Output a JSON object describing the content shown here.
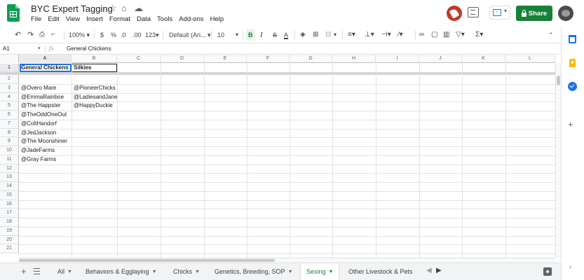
{
  "header": {
    "title": "BYC Expert Tagging",
    "menu": [
      "File",
      "Edit",
      "View",
      "Insert",
      "Format",
      "Data",
      "Tools",
      "Add-ons",
      "Help"
    ],
    "share_label": "Share"
  },
  "toolbar": {
    "zoom": "100%",
    "currency": "$",
    "percent": "%",
    "decimal_decrease": ".0",
    "decimal_increase": ".00",
    "more_formats": "123",
    "font": "Default (Ari...",
    "font_size": "10",
    "bold": "B",
    "italic": "I",
    "strike": "S",
    "text_color": "A",
    "functions": "Σ"
  },
  "formula_bar": {
    "cell_ref": "A1",
    "fx": "fx",
    "value": "General Chickens"
  },
  "grid": {
    "columns": [
      "A",
      "B",
      "C",
      "D",
      "E",
      "F",
      "G",
      "H",
      "I",
      "J",
      "K",
      "L"
    ],
    "rows": [
      "1",
      "2",
      "3",
      "4",
      "5",
      "6",
      "7",
      "8",
      "9",
      "10",
      "11",
      "12",
      "13",
      "14",
      "15",
      "16",
      "17",
      "18",
      "19",
      "20",
      "21"
    ],
    "header_row": {
      "A": "General Chickens",
      "B": "Silkies"
    },
    "column_a": [
      "@Overo Mare",
      "@EmmaRainboe",
      "@The Happster",
      "@TheOddOneOut",
      "@ColtHandorf",
      "@JedJackson",
      "@The Moonshiner",
      "@JadeFarms",
      "@Gray Farms"
    ],
    "column_b": [
      "@PioneerChicks",
      "@LadiesandJane",
      "@HappyDuckie"
    ]
  },
  "sheets": {
    "tabs": [
      {
        "label": "All"
      },
      {
        "label": "Behaviors & Egglaying"
      },
      {
        "label": "Chicks"
      },
      {
        "label": "Genetics, Breeding, SOP"
      },
      {
        "label": "Sexing",
        "active": true
      },
      {
        "label": "Other Livestock & Pets"
      }
    ]
  },
  "colors": {
    "brand_green": "#188038",
    "selection_blue": "#1a73e8",
    "keep_yellow": "#fbbc04"
  }
}
